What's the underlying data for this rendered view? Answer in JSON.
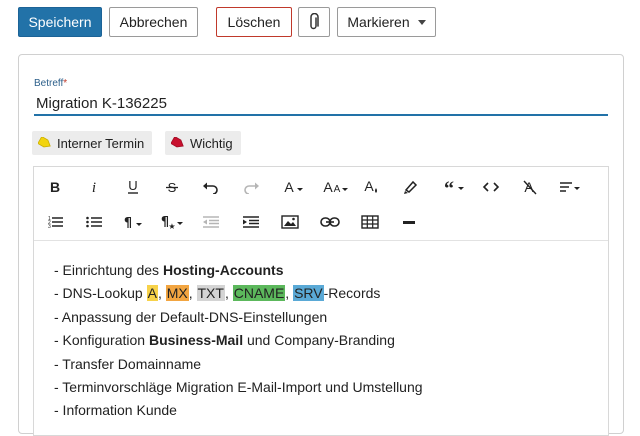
{
  "toolbar": {
    "save_label": "Speichern",
    "cancel_label": "Abbrechen",
    "delete_label": "Löschen",
    "mark_label": "Markieren"
  },
  "subject": {
    "label": "Betreff",
    "required_mark": "*",
    "value": "Migration K-136225"
  },
  "tags": [
    {
      "label": "Interner Termin",
      "icon": "tag-icon",
      "color": "#f2d40f"
    },
    {
      "label": "Wichtig",
      "icon": "tag-icon",
      "color": "#c8102e"
    }
  ],
  "editor_toolbar": {
    "row1": [
      "bold-icon",
      "italic-icon",
      "underline-icon",
      "strikethrough-icon",
      "undo-icon",
      "redo-icon",
      "font-color-icon",
      "font-size-icon",
      "text-color-icon",
      "highlighter-icon",
      "quote-icon",
      "code-icon",
      "clear-format-icon",
      "align-icon"
    ],
    "row2": [
      "ordered-list-icon",
      "unordered-list-icon",
      "paragraph-icon",
      "paragraph-style-icon",
      "outdent-icon",
      "indent-icon",
      "image-icon",
      "link-icon",
      "table-icon",
      "horizontal-rule-icon"
    ]
  },
  "content": {
    "line1": {
      "prefix": "- Einrichtung des ",
      "bold": "Hosting-Accounts"
    },
    "line2": {
      "prefix": "- DNS-Lookup ",
      "sep": ", ",
      "suffix": "-Records",
      "records": [
        {
          "text": "A",
          "color": "#f7d24a"
        },
        {
          "text": "MX",
          "color": "#f2a541"
        },
        {
          "text": "TXT",
          "color": "#d4d4d4"
        },
        {
          "text": "CNAME",
          "color": "#5cb85c"
        },
        {
          "text": "SRV",
          "color": "#5aa9d6"
        }
      ]
    },
    "line3": "- Anpassung der Default-DNS-Einstellungen",
    "line4": {
      "prefix": "- Konfiguration ",
      "bold": "Business-Mail",
      "suffix": " und Company-Branding"
    },
    "line5": "- Transfer Domainname",
    "line6": "- Terminvorschläge Migration E-Mail-Import und Umstellung",
    "line7": "- Information Kunde"
  }
}
